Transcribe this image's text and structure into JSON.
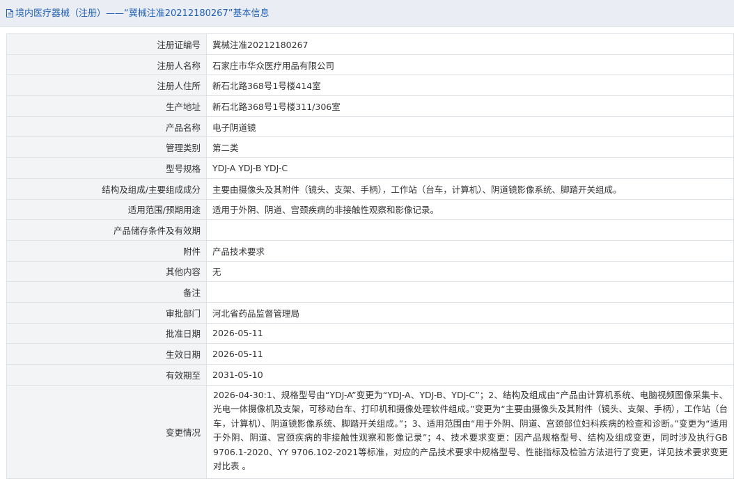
{
  "header": {
    "title": "境内医疗器械（注册）——“冀械注准20212180267”基本信息",
    "icon": "document-icon",
    "accent_color": "#1f5fb3"
  },
  "rows": [
    {
      "label": "注册证编号",
      "value": "冀械注准20212180267"
    },
    {
      "label": "注册人名称",
      "value": "石家庄市华众医疗用品有限公司"
    },
    {
      "label": "注册人住所",
      "value": "新石北路368号1号楼414室"
    },
    {
      "label": "生产地址",
      "value": "新石北路368号1号楼311/306室"
    },
    {
      "label": "产品名称",
      "value": "电子阴道镜"
    },
    {
      "label": "管理类别",
      "value": "第二类"
    },
    {
      "label": "型号规格",
      "value": "YDJ-A YDJ-B YDJ-C"
    },
    {
      "label": "结构及组成/主要组成成分",
      "value": "主要由摄像头及其附件（镜头、支架、手柄），工作站（台车，计算机）、阴道镜影像系统、脚踏开关组成。"
    },
    {
      "label": "适用范围/预期用途",
      "value": "适用于外阴、阴道、宫颈疾病的非接触性观察和影像记录。"
    },
    {
      "label": "产品储存条件及有效期",
      "value": ""
    },
    {
      "label": "附件",
      "value": "产品技术要求"
    },
    {
      "label": "其他内容",
      "value": "无"
    },
    {
      "label": "备注",
      "value": ""
    },
    {
      "label": "审批部门",
      "value": "河北省药品监督管理局"
    },
    {
      "label": "批准日期",
      "value": "2026-05-11"
    },
    {
      "label": "生效日期",
      "value": "2026-05-11"
    },
    {
      "label": "有效期至",
      "value": "2031-05-10"
    },
    {
      "label": "变更情况",
      "value": "2026-04-30:1、规格型号由“YDJ-A”变更为“YDJ-A、YDJ-B、YDJ-C”；2、结构及组成由“产品由计算机系统、电脑视频图像采集卡、光电一体摄像机及支架，可移动台车、打印机和摄像处理软件组成。”变更为“主要由摄像头及其附件（镜头、支架、手柄），工作站（台车，计算机）、阴道镜影像系统、脚踏开关组成。”；3、适用范围由“用于外阴、阴道、宫颈部位妇科疾病的检查和诊断。”变更为“适用于外阴、阴道、宫颈疾病的非接触性观察和影像记录”；4、技术要求变更：因产品规格型号、结构及组成变更，同时涉及执行GB 9706.1-2020、YY 9706.102-2021等标准，对应的产品技术要求中规格型号、性能指标及检验方法进行了变更，详见技术要求变更对比表 。"
    }
  ]
}
